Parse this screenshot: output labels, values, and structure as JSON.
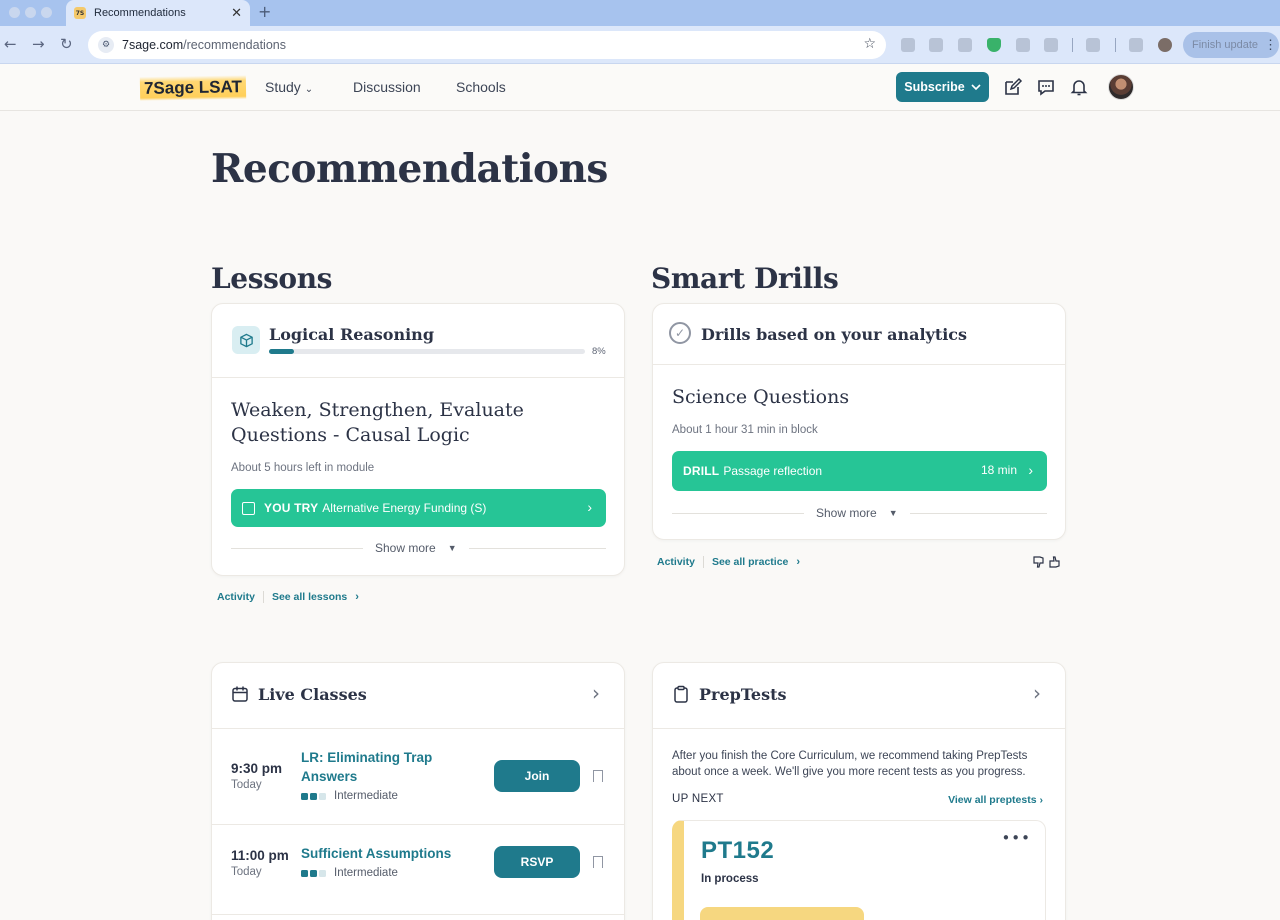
{
  "browser": {
    "tab_title": "Recommendations",
    "favicon_text": "7S",
    "url_host": "7sage.com",
    "url_path": "/recommendations",
    "finish_update_label": "Finish update"
  },
  "header": {
    "logo": "7Sage LSAT",
    "nav": [
      "Study",
      "Discussion",
      "Schools"
    ],
    "subscribe_label": "Subscribe"
  },
  "page": {
    "title": "Recommendations"
  },
  "lessons": {
    "section_title": "Lessons",
    "module_title": "Logical Reasoning",
    "progress": 8,
    "progress_label": "8%",
    "lesson_title": "Weaken, Strengthen, Evaluate Questions - Causal Logic",
    "time_left": "About 5 hours left in module",
    "item_tag": "YOU TRY",
    "item_label": "Alternative Energy Funding (S)",
    "show_more": "Show more",
    "links": [
      "Activity",
      "See all lessons"
    ]
  },
  "smart_drills": {
    "section_title": "Smart Drills",
    "header_title": "Drills based on your analytics",
    "drill_title": "Science Questions",
    "time_in_block": "About 1 hour 31 min in block",
    "item_tag": "DRILL",
    "item_label": "Passage reflection",
    "item_time": "18 min",
    "show_more": "Show more",
    "links": [
      "Activity",
      "See all practice"
    ]
  },
  "live_classes": {
    "title": "Live Classes",
    "classes": [
      {
        "time": "9:30 pm",
        "day": "Today",
        "name": "LR: Eliminating Trap Answers",
        "level": "Intermediate",
        "action": "Join"
      },
      {
        "time": "11:00 pm",
        "day": "Today",
        "name": "Sufficient Assumptions",
        "level": "Intermediate",
        "action": "RSVP"
      }
    ]
  },
  "preptests": {
    "title": "PrepTests",
    "description": "After you finish the Core Curriculum, we recommend taking PrepTests about once a week. We'll give you more recent tests as you progress.",
    "up_next": "UP NEXT",
    "view_all": "View all preptests",
    "test_name": "PT152",
    "test_status": "In process"
  },
  "colors": {
    "accent": "#1f7a8c",
    "green": "#26c596",
    "logo_highlight": "#ffd873",
    "pt_stripe": "#f6d780"
  }
}
